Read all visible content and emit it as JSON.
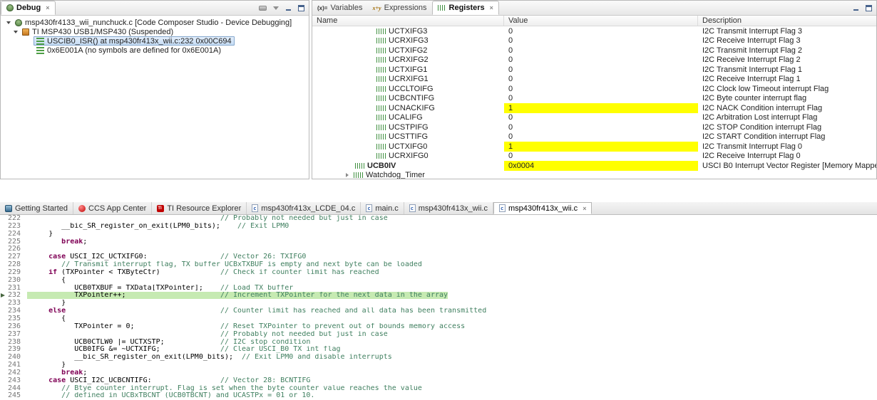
{
  "colors": {
    "value_highlight": "#ffff00",
    "current_line": "#c6eab2",
    "selection_blue": "#c6ddf5",
    "comment_green": "#3f7f5f",
    "keyword_purple": "#7f0055"
  },
  "debug_panel": {
    "tab_label": "Debug",
    "toolbar": [
      "disconnect-icon",
      "view-menu-icon",
      "minimize-icon",
      "maximize-icon"
    ],
    "tree": [
      {
        "label": "msp430fr4133_wii_nunchuck.c [Code Composer Studio - Device Debugging]",
        "indent": 0,
        "expanded": true,
        "icon": "ccs-debug-session-icon",
        "selected": false
      },
      {
        "label": "TI MSP430 USB1/MSP430 (Suspended)",
        "indent": 1,
        "expanded": true,
        "icon": "device-icon",
        "selected": false
      },
      {
        "label": "USCIB0_ISR() at msp430fr413x_wii.c:232 0x00C694",
        "indent": 2,
        "icon": "stack-frame-icon",
        "selected": true
      },
      {
        "label": "0x6E001A  (no symbols are defined for 0x6E001A)",
        "indent": 2,
        "icon": "stack-frame-icon",
        "selected": false
      }
    ]
  },
  "registers_panel": {
    "tabs": [
      {
        "label": "Variables",
        "icon": "variables-icon",
        "active": false
      },
      {
        "label": "Expressions",
        "icon": "expressions-icon",
        "active": false
      },
      {
        "label": "Registers",
        "icon": "registers-icon",
        "active": true
      }
    ],
    "corner": [
      "minimize-icon",
      "maximize-icon"
    ],
    "columns": [
      "Name",
      "Value",
      "Description"
    ],
    "rows": [
      {
        "name": "UCTXIFG3",
        "value": "0",
        "description": "I2C Transmit Interrupt Flag 3",
        "indent": 2,
        "highlight": false
      },
      {
        "name": "UCRXIFG3",
        "value": "0",
        "description": "I2C Receive Interrupt Flag 3",
        "indent": 2,
        "highlight": false
      },
      {
        "name": "UCTXIFG2",
        "value": "0",
        "description": "I2C Transmit Interrupt Flag 2",
        "indent": 2,
        "highlight": false
      },
      {
        "name": "UCRXIFG2",
        "value": "0",
        "description": "I2C Receive Interrupt Flag 2",
        "indent": 2,
        "highlight": false
      },
      {
        "name": "UCTXIFG1",
        "value": "0",
        "description": "I2C Transmit Interrupt Flag 1",
        "indent": 2,
        "highlight": false
      },
      {
        "name": "UCRXIFG1",
        "value": "0",
        "description": "I2C Receive Interrupt Flag 1",
        "indent": 2,
        "highlight": false
      },
      {
        "name": "UCCLTOIFG",
        "value": "0",
        "description": "I2C Clock low Timeout interrupt Flag",
        "indent": 2,
        "highlight": false
      },
      {
        "name": "UCBCNTIFG",
        "value": "0",
        "description": "I2C Byte counter interrupt flag",
        "indent": 2,
        "highlight": false
      },
      {
        "name": "UCNACKIFG",
        "value": "1",
        "description": "I2C NACK Condition interrupt Flag",
        "indent": 2,
        "highlight": true
      },
      {
        "name": "UCALIFG",
        "value": "0",
        "description": "I2C Arbitration Lost interrupt Flag",
        "indent": 2,
        "highlight": false
      },
      {
        "name": "UCSTPIFG",
        "value": "0",
        "description": "I2C STOP Condition interrupt Flag",
        "indent": 2,
        "highlight": false
      },
      {
        "name": "UCSTTIFG",
        "value": "0",
        "description": "I2C START Condition interrupt Flag",
        "indent": 2,
        "highlight": false
      },
      {
        "name": "UCTXIFG0",
        "value": "1",
        "description": "I2C Transmit Interrupt Flag 0",
        "indent": 2,
        "highlight": true
      },
      {
        "name": "UCRXIFG0",
        "value": "0",
        "description": "I2C Receive Interrupt Flag 0",
        "indent": 2,
        "highlight": false
      },
      {
        "name": "UCB0IV",
        "value": "0x0004",
        "description": "USCI B0 Interrupt Vector Register [Memory Mapped]",
        "indent": 1,
        "highlight": true,
        "bold": true
      },
      {
        "name": "Watchdog_Timer",
        "value": "",
        "description": "",
        "indent": 0,
        "highlight": false,
        "expandable": true
      }
    ]
  },
  "editor": {
    "tabs": [
      {
        "label": "Getting Started",
        "icon": "getting-started-icon",
        "active": false
      },
      {
        "label": "CCS App Center",
        "icon": "app-center-icon",
        "active": false
      },
      {
        "label": "TI Resource Explorer",
        "icon": "resource-explorer-icon",
        "active": false
      },
      {
        "label": "msp430fr413x_LCDE_04.c",
        "icon": "c-file-icon",
        "active": false
      },
      {
        "label": "main.c",
        "icon": "c-file-icon",
        "active": false
      },
      {
        "label": "msp430fr413x_wii.c",
        "icon": "c-file-icon",
        "active": false
      },
      {
        "label": "msp430fr413x_wii.c",
        "icon": "c-file-icon",
        "active": true
      }
    ],
    "code": [
      {
        "n": 222,
        "segs": [
          {
            "t": "c",
            "s": "                                             "
          },
          {
            "t": "m",
            "s": "// Probably not needed but just in case"
          }
        ]
      },
      {
        "n": 223,
        "segs": [
          {
            "t": "c",
            "s": "        __bic_SR_register_on_exit(LPM0_bits);    "
          },
          {
            "t": "m",
            "s": "// Exit LPM0"
          }
        ]
      },
      {
        "n": 224,
        "segs": [
          {
            "t": "c",
            "s": "     }"
          }
        ]
      },
      {
        "n": 225,
        "segs": [
          {
            "t": "c",
            "s": "        "
          },
          {
            "t": "k",
            "s": "break"
          },
          {
            "t": "c",
            "s": ";"
          }
        ]
      },
      {
        "n": 226,
        "segs": []
      },
      {
        "n": 227,
        "segs": [
          {
            "t": "c",
            "s": "     "
          },
          {
            "t": "k",
            "s": "case"
          },
          {
            "t": "c",
            "s": " USCI_I2C_UCTXIFG0:                 "
          },
          {
            "t": "m",
            "s": "// Vector 26: TXIFG0"
          }
        ]
      },
      {
        "n": 228,
        "segs": [
          {
            "t": "c",
            "s": "        "
          },
          {
            "t": "m",
            "s": "// Transmit interrupt flag, TX buffer UCBxTXBUF is empty and next byte can be loaded"
          }
        ]
      },
      {
        "n": 229,
        "segs": [
          {
            "t": "c",
            "s": "     "
          },
          {
            "t": "k",
            "s": "if"
          },
          {
            "t": "c",
            "s": " (TXPointer < TXByteCtr)              "
          },
          {
            "t": "m",
            "s": "// Check if counter limit has reached"
          }
        ]
      },
      {
        "n": 230,
        "segs": [
          {
            "t": "c",
            "s": "        {"
          }
        ]
      },
      {
        "n": 231,
        "segs": [
          {
            "t": "c",
            "s": "           UCB0TXBUF = TXData[TXPointer];    "
          },
          {
            "t": "m",
            "s": "// Load TX buffer"
          }
        ]
      },
      {
        "n": 232,
        "cur": true,
        "segs": [
          {
            "t": "c",
            "s": "           TXPointer++;                      "
          },
          {
            "t": "m",
            "s": "// Increment TXPointer for the next data in the array"
          }
        ]
      },
      {
        "n": 233,
        "segs": [
          {
            "t": "c",
            "s": "        }"
          }
        ]
      },
      {
        "n": 234,
        "segs": [
          {
            "t": "c",
            "s": "     "
          },
          {
            "t": "k",
            "s": "else"
          },
          {
            "t": "c",
            "s": "                                    "
          },
          {
            "t": "m",
            "s": "// Counter limit has reached and all data has been transmitted"
          }
        ]
      },
      {
        "n": 235,
        "segs": [
          {
            "t": "c",
            "s": "        {"
          }
        ]
      },
      {
        "n": 236,
        "segs": [
          {
            "t": "c",
            "s": "           TXPointer = 0;                    "
          },
          {
            "t": "m",
            "s": "// Reset TXPointer to prevent out of bounds memory access"
          }
        ]
      },
      {
        "n": 237,
        "segs": [
          {
            "t": "c",
            "s": "                                             "
          },
          {
            "t": "m",
            "s": "// Probably not needed but just in case"
          }
        ]
      },
      {
        "n": 238,
        "segs": [
          {
            "t": "c",
            "s": "           UCB0CTLW0 |= UCTXSTP;             "
          },
          {
            "t": "m",
            "s": "// I2C stop condition"
          }
        ]
      },
      {
        "n": 239,
        "segs": [
          {
            "t": "c",
            "s": "           UCB0IFG &= ~UCTXIFG;              "
          },
          {
            "t": "m",
            "s": "// Clear USCI_B0 TX int flag"
          }
        ]
      },
      {
        "n": 240,
        "segs": [
          {
            "t": "c",
            "s": "           __bic_SR_register_on_exit(LPM0_bits);  "
          },
          {
            "t": "m",
            "s": "// Exit LPM0 and disable interrupts"
          }
        ]
      },
      {
        "n": 241,
        "segs": [
          {
            "t": "c",
            "s": "        }"
          }
        ]
      },
      {
        "n": 242,
        "segs": [
          {
            "t": "c",
            "s": "        "
          },
          {
            "t": "k",
            "s": "break"
          },
          {
            "t": "c",
            "s": ";"
          }
        ]
      },
      {
        "n": 243,
        "segs": [
          {
            "t": "c",
            "s": "     "
          },
          {
            "t": "k",
            "s": "case"
          },
          {
            "t": "c",
            "s": " USCI_I2C_UCBCNTIFG:                "
          },
          {
            "t": "m",
            "s": "// Vector 28: BCNTIFG"
          }
        ]
      },
      {
        "n": 244,
        "segs": [
          {
            "t": "c",
            "s": "        "
          },
          {
            "t": "m",
            "s": "// Btye counter interrupt. Flag is set when the byte counter value reaches the value"
          }
        ]
      },
      {
        "n": 245,
        "segs": [
          {
            "t": "c",
            "s": "        "
          },
          {
            "t": "m",
            "s": "// defined in UCBxTBCNT (UCB0TBCNT) and UCASTPx = 01 or 10."
          }
        ]
      }
    ]
  }
}
